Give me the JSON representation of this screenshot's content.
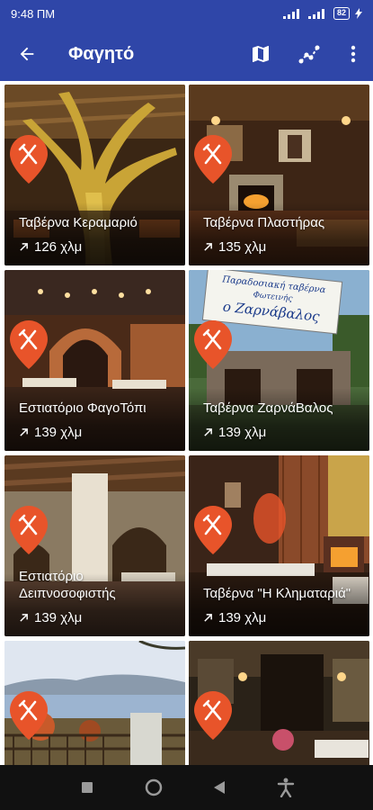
{
  "status": {
    "time": "9:48 ΠΜ",
    "battery": "82"
  },
  "app_bar": {
    "title": "Φαγητό"
  },
  "places": [
    {
      "name": "Ταβέρνα Κεραμαριό",
      "distance": "126 χλμ"
    },
    {
      "name": "Ταβέρνα Πλαστήρας",
      "distance": "135 χλμ"
    },
    {
      "name": "Εστιατόριο ΦαγοΤόπι",
      "distance": "139 χλμ"
    },
    {
      "name": "Ταβέρνα ΖαρνάΒαλος",
      "distance": "139 χλμ"
    },
    {
      "name": "Εστιατόριο Δειπνοσοφιστής",
      "distance": "139 χλμ"
    },
    {
      "name": "Ταβέρνα \"Η Κληματαριά\"",
      "distance": "139 χλμ"
    },
    {
      "name": "",
      "distance": ""
    },
    {
      "name": "",
      "distance": ""
    }
  ],
  "sign_text": {
    "line1": "Παραδοσιακή ταβέρνα",
    "line2": "Φωτεινής",
    "line3": "ο Ζαρνάβαλος"
  },
  "colors": {
    "primary": "#2f46a8",
    "pin": "#e8542a"
  }
}
